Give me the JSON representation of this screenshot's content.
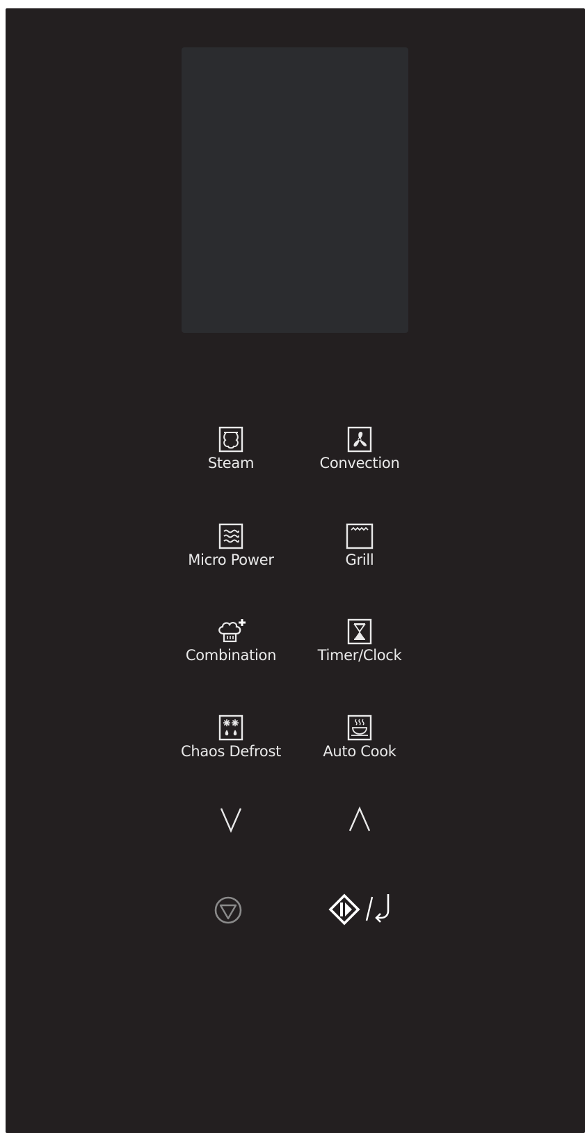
{
  "colors": {
    "panel_background": "#231f20",
    "display_background": "#2b2c2f",
    "label_color": "#e9e9e9",
    "stop_icon_color": "#8a8a8a"
  },
  "buttons": {
    "steam": {
      "label": "Steam",
      "icon": "steam-icon"
    },
    "convection": {
      "label": "Convection",
      "icon": "fan-icon"
    },
    "micro_power": {
      "label": "Micro Power",
      "icon": "microwave-waves-icon"
    },
    "grill": {
      "label": "Grill",
      "icon": "grill-icon"
    },
    "combination": {
      "label": "Combination",
      "icon": "chef-hat-plus-icon"
    },
    "timer_clock": {
      "label": "Timer/Clock",
      "icon": "hourglass-icon"
    },
    "chaos_defrost": {
      "label": "Chaos Defrost",
      "icon": "snowflake-drops-icon"
    },
    "auto_cook": {
      "label": "Auto Cook",
      "icon": "dish-steam-icon"
    }
  },
  "controls": {
    "down": {
      "icon": "chevron-down-icon"
    },
    "up": {
      "icon": "chevron-up-icon"
    },
    "stop": {
      "icon": "stop-cancel-icon"
    },
    "start": {
      "icon": "start-enter-icon"
    }
  }
}
